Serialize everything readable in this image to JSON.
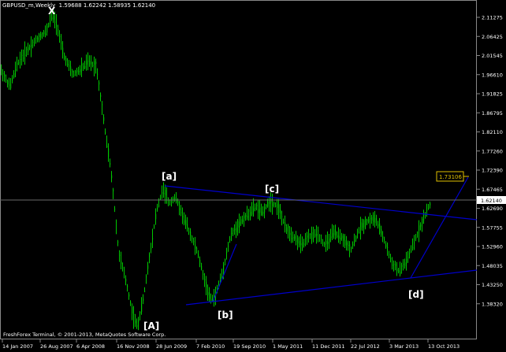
{
  "header": {
    "symbol": "GBPUSD_m,Weekly",
    "ohlc": "1.59688 1.62242 1.58935 1.62140"
  },
  "footer": {
    "copyright": "FreshForex Terminal, © 2001-2013, MetaQuotes Software Corp."
  },
  "colors": {
    "background": "#000000",
    "candles": "#00c800",
    "trendline": "#0000cc",
    "price_line": "#6a6a6a",
    "target_label_border": "#e0c000",
    "target_label_text": "#e0c000",
    "text": "#ffffff"
  },
  "chart_data": {
    "type": "candlestick",
    "y_ticks": [
      "2.11275",
      "2.06425",
      "2.01545",
      "1.96610",
      "1.91825",
      "1.86795",
      "1.82110",
      "1.77260",
      "1.72390",
      "1.67465",
      "1.62690",
      "1.57755",
      "1.52960",
      "1.48035",
      "1.43250",
      "1.38320"
    ],
    "x_ticks": [
      "14 Jan 2007",
      "26 Aug 2007",
      "6 Apr 2008",
      "16 Nov 2008",
      "28 Jun 2009",
      "7 Feb 2010",
      "19 Sep 2010",
      "1 May 2011",
      "11 Dec 2011",
      "22 Jul 2012",
      "3 Mar 2013",
      "13 Oct 2013"
    ],
    "current_price": "1.62140",
    "target_price": "1.73106",
    "wave_labels": [
      "X",
      "[a]",
      "[b]",
      "[c]",
      "[d]",
      "[A]"
    ]
  }
}
